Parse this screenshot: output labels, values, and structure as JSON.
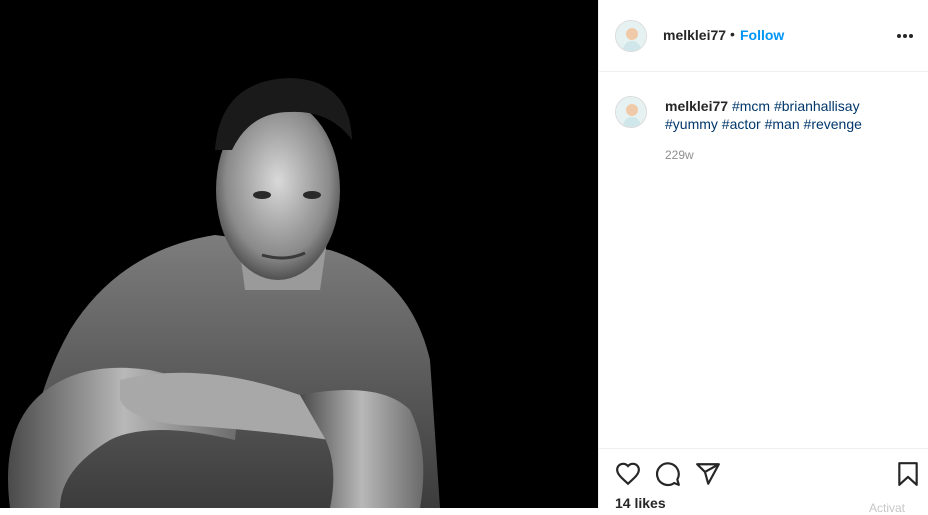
{
  "post": {
    "photo_icon": "portrait-photo",
    "username": "melklei77",
    "separator": "•",
    "follow_label": "Follow",
    "more_icon": "more-horizontal-icon"
  },
  "caption": {
    "username": "melklei77",
    "hashtags": [
      "#mcm",
      "#brianhallisay",
      "#yummy",
      "#actor",
      "#man",
      "#revenge"
    ],
    "timestamp": "229w"
  },
  "actions": {
    "like_icon": "heart-icon",
    "comment_icon": "comment-icon",
    "share_icon": "share-icon",
    "save_icon": "bookmark-icon",
    "likes_text": "14 likes",
    "ghost_text": "Activat"
  },
  "colors": {
    "accent": "#0095f6",
    "hashtag": "#00376b",
    "muted": "#8e8e8e"
  }
}
